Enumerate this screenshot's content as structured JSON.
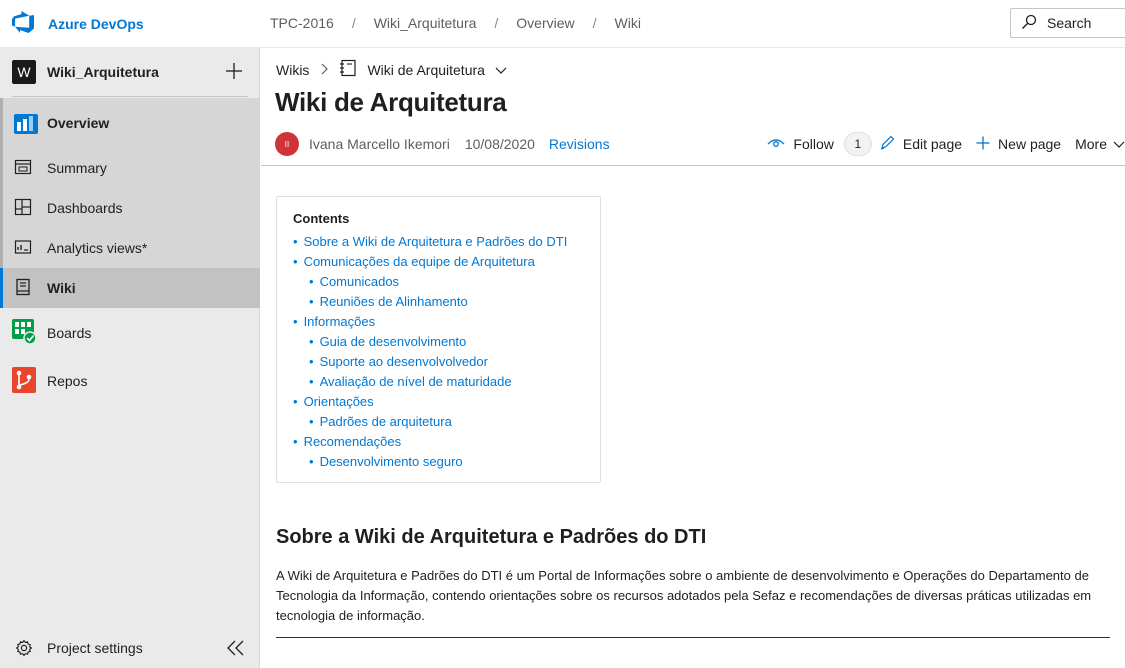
{
  "topbar": {
    "brand": "Azure DevOps",
    "breadcrumbs": [
      "TPC-2016",
      "Wiki_Arquitetura",
      "Overview",
      "Wiki"
    ],
    "search_label": "Search"
  },
  "sidebar": {
    "project_initial": "W",
    "project_name": "Wiki_Arquitetura",
    "items": {
      "overview": "Overview",
      "summary": "Summary",
      "dashboards": "Dashboards",
      "analytics": "Analytics views*",
      "wiki": "Wiki",
      "boards": "Boards",
      "repos": "Repos"
    },
    "project_settings": "Project settings"
  },
  "main": {
    "wiki_root": "Wikis",
    "wiki_name": "Wiki de Arquitetura",
    "page_title": "Wiki de Arquitetura",
    "author_initials": "II",
    "author": "Ivana Marcello Ikemori",
    "date": "10/08/2020",
    "revisions": "Revisions",
    "follow": "Follow",
    "follow_count": "1",
    "edit_page": "Edit page",
    "new_page": "New page",
    "more": "More",
    "toc": {
      "title": "Contents",
      "items": [
        {
          "label": "Sobre a Wiki de Arquitetura e Padrões do DTI",
          "level": 1
        },
        {
          "label": "Comunicações da equipe de Arquitetura",
          "level": 1
        },
        {
          "label": "Comunicados",
          "level": 2
        },
        {
          "label": "Reuniões de Alinhamento",
          "level": 2
        },
        {
          "label": "Informações",
          "level": 1
        },
        {
          "label": "Guia de desenvolvimento",
          "level": 2
        },
        {
          "label": "Suporte ao desenvolvolvedor",
          "level": 2
        },
        {
          "label": "Avaliação de nível de maturidade",
          "level": 2
        },
        {
          "label": "Orientações",
          "level": 1
        },
        {
          "label": "Padrões de arquitetura",
          "level": 2
        },
        {
          "label": "Recomendações",
          "level": 1
        },
        {
          "label": "Desenvolvimento seguro",
          "level": 2
        }
      ]
    },
    "section_title": "Sobre a Wiki de Arquitetura e Padrões do DTI",
    "section_text": "A Wiki de Arquitetura e Padrões do DTI é um Portal de Informações sobre o ambiente de desenvolvimento e Operações do Departamento de Tecnologia da Informação, contendo orientações sobre os recursos adotados pela Sefaz e recomendações de diversas práticas utilizadas em tecnologia de informação."
  },
  "colors": {
    "accent": "#0078d4",
    "sidebar_bg": "#eaeaea",
    "nav_group_bg": "#d6d6d6",
    "selected_bg": "#c2c2c2",
    "author_avatar": "#d13438"
  }
}
